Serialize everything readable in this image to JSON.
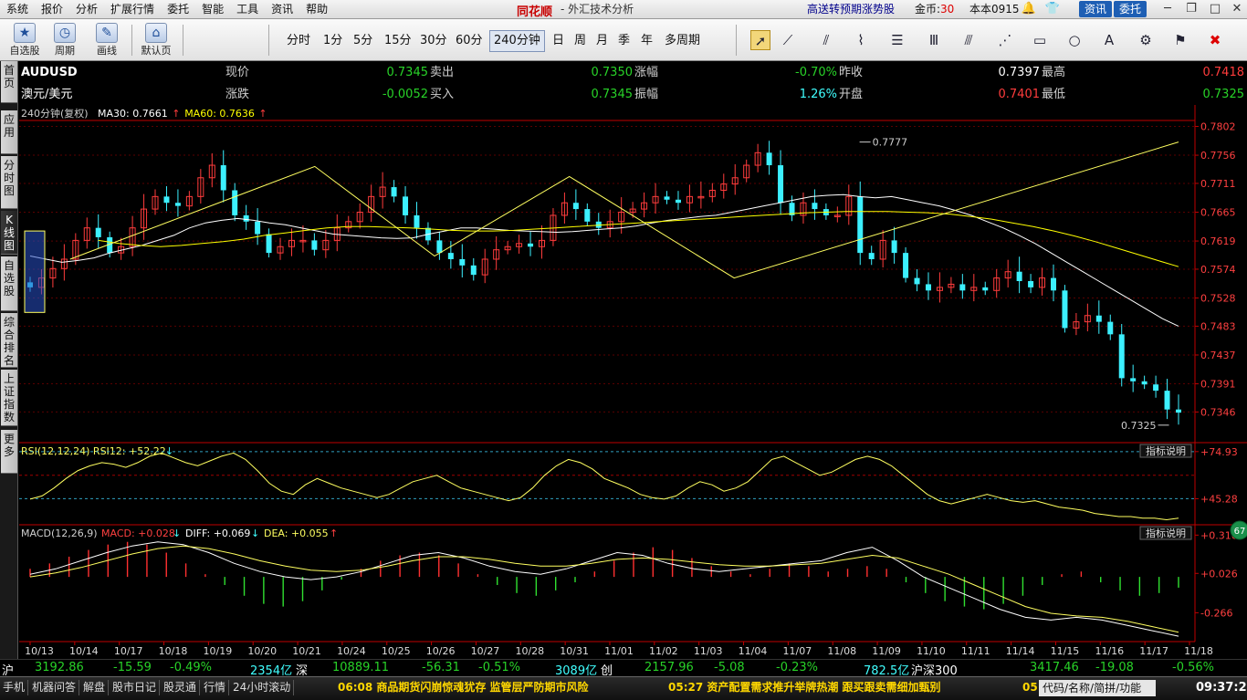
{
  "menu": {
    "items": [
      "系统",
      "报价",
      "分析",
      "扩展行情",
      "委托",
      "智能",
      "工具",
      "资讯",
      "帮助"
    ],
    "brand": "同花顺",
    "app_title": "- 外汇技术分析",
    "promo": "高送转预期涨势股",
    "coins_label": "金币:",
    "coins_value": "30",
    "version": "本本0915",
    "btn_info": "资讯",
    "btn_trade": "委托"
  },
  "toolbar": {
    "big_buttons": [
      "自选股",
      "周期",
      "画线",
      "默认页"
    ],
    "periods": [
      "分时",
      "1分",
      "5分",
      "15分",
      "30分",
      "60分",
      "240分钟",
      "日",
      "周",
      "月",
      "季",
      "年",
      "多周期"
    ],
    "active_period": "240分钟"
  },
  "left_tabs": [
    "首页",
    "应用",
    "分时图",
    "K线图",
    "自选股",
    "综合排名",
    "上证指数",
    "更多"
  ],
  "quote": {
    "code": "AUDUSD",
    "name": "澳元/美元",
    "labels": {
      "now": "现价",
      "sell": "卖出",
      "rise": "涨幅",
      "prev": "昨收",
      "high": "最高",
      "chg": "涨跌",
      "buy": "买入",
      "amp": "振幅",
      "open": "开盘",
      "low": "最低"
    },
    "now": "0.7345",
    "sell": "0.7350",
    "rise": "-0.70%",
    "prev": "0.7397",
    "high": "0.7418",
    "chg": "-0.0052",
    "buy": "0.7345",
    "amp": "1.26%",
    "open": "0.7401",
    "low": "0.7325"
  },
  "chart_data": {
    "type": "candlestick",
    "title": "240分钟(复权)",
    "ma_legend": [
      {
        "name": "MA30",
        "value": "0.7661",
        "arrow": "↑",
        "color": "#ffffff"
      },
      {
        "name": "MA60",
        "value": "0.7636",
        "arrow": "↑",
        "color": "#ffff00"
      }
    ],
    "ylim": [
      0.73,
      0.781
    ],
    "y_ticks": [
      "0.7802",
      "0.7756",
      "0.7711",
      "0.7665",
      "0.7619",
      "0.7574",
      "0.7528",
      "0.7483",
      "0.7437",
      "0.7391",
      "0.7346"
    ],
    "x_labels": [
      "10/13",
      "10/14",
      "10/17",
      "10/18",
      "10/19",
      "10/20",
      "10/21",
      "10/24",
      "10/25",
      "10/26",
      "10/27",
      "10/28",
      "10/31",
      "11/01",
      "11/02",
      "11/03",
      "11/04",
      "11/07",
      "11/08",
      "11/09",
      "11/10",
      "11/11",
      "11/14",
      "11/15",
      "11/16",
      "11/17",
      "11/18"
    ],
    "high_annotation": "0.7777",
    "low_annotation": "0.7325",
    "close_path": [
      0.7545,
      0.756,
      0.7575,
      0.759,
      0.762,
      0.764,
      0.7625,
      0.76,
      0.761,
      0.764,
      0.767,
      0.769,
      0.768,
      0.7675,
      0.769,
      0.772,
      0.774,
      0.77,
      0.766,
      0.765,
      0.763,
      0.76,
      0.761,
      0.762,
      0.762,
      0.7605,
      0.762,
      0.764,
      0.765,
      0.7665,
      0.769,
      0.7705,
      0.769,
      0.766,
      0.764,
      0.762,
      0.76,
      0.759,
      0.758,
      0.7565,
      0.759,
      0.7605,
      0.761,
      0.7615,
      0.761,
      0.762,
      0.766,
      0.768,
      0.767,
      0.765,
      0.764,
      0.765,
      0.7665,
      0.767,
      0.768,
      0.769,
      0.7685,
      0.768,
      0.769,
      0.769,
      0.77,
      0.771,
      0.772,
      0.774,
      0.776,
      0.774,
      0.768,
      0.766,
      0.768,
      0.767,
      0.766,
      0.766,
      0.769,
      0.76,
      0.759,
      0.762,
      0.76,
      0.756,
      0.755,
      0.754,
      0.7545,
      0.755,
      0.754,
      0.7545,
      0.754,
      0.756,
      0.757,
      0.7555,
      0.7545,
      0.756,
      0.754,
      0.748,
      0.749,
      0.75,
      0.749,
      0.747,
      0.74,
      0.7395,
      0.739,
      0.738,
      0.735,
      0.7345
    ],
    "ma30": [
      0.7595,
      0.759,
      0.7585,
      0.7588,
      0.7592,
      0.76,
      0.7606,
      0.7612,
      0.762,
      0.7628,
      0.764,
      0.7648,
      0.7652,
      0.7655,
      0.7652,
      0.7648,
      0.7645,
      0.764,
      0.7635,
      0.763,
      0.7628,
      0.7626,
      0.7624,
      0.7623,
      0.7624,
      0.763,
      0.7635,
      0.764,
      0.764,
      0.7638,
      0.7636,
      0.7635,
      0.7634,
      0.7633,
      0.7634,
      0.7636,
      0.7638,
      0.764,
      0.7643,
      0.7648,
      0.7652,
      0.7655,
      0.7658,
      0.766,
      0.7665,
      0.767,
      0.7675,
      0.768,
      0.7685,
      0.769,
      0.7692,
      0.7693,
      0.769,
      0.7688,
      0.769,
      0.7685,
      0.768,
      0.7675,
      0.7668,
      0.766,
      0.765,
      0.764,
      0.7628,
      0.7615,
      0.76,
      0.7585,
      0.757,
      0.7555,
      0.754,
      0.7525,
      0.751,
      0.7495,
      0.7483
    ],
    "ma60": [
      0.762,
      0.7615,
      0.7612,
      0.761,
      0.7612,
      0.7615,
      0.7618,
      0.7622,
      0.7628,
      0.7632,
      0.7636,
      0.764,
      0.7642,
      0.7642,
      0.7641,
      0.764,
      0.7638,
      0.7636,
      0.7635,
      0.7635,
      0.7636,
      0.7638,
      0.764,
      0.7642,
      0.7644,
      0.7646,
      0.7648,
      0.765,
      0.7652,
      0.7654,
      0.7656,
      0.7658,
      0.766,
      0.7662,
      0.7664,
      0.7665,
      0.7666,
      0.7666,
      0.7666,
      0.7665,
      0.7664,
      0.7662,
      0.7658,
      0.7654,
      0.7648,
      0.7642,
      0.7635,
      0.7627,
      0.7618,
      0.7608,
      0.7598,
      0.7588,
      0.7578
    ],
    "zigzag": [
      [
        8,
        0.759
      ],
      [
        57,
        0.7738
      ],
      [
        81,
        0.7595
      ],
      [
        108,
        0.7722
      ],
      [
        141,
        0.756
      ],
      [
        230,
        0.7777
      ]
    ],
    "rsi": {
      "legend": "RSI(12,12,24)  RSI12: +52.22",
      "arrow": "↓",
      "y_ticks": [
        "+74.93",
        "+45.28"
      ],
      "ylim": [
        30,
        80
      ],
      "values": [
        45,
        47,
        52,
        58,
        63,
        66,
        68,
        67,
        65,
        68,
        72,
        74,
        71,
        68,
        66,
        69,
        72,
        74,
        70,
        63,
        55,
        50,
        48,
        54,
        58,
        55,
        52,
        50,
        48,
        46,
        48,
        52,
        56,
        58,
        60,
        56,
        52,
        50,
        48,
        46,
        44,
        46,
        52,
        60,
        66,
        70,
        68,
        64,
        58,
        55,
        52,
        48,
        46,
        45,
        47,
        52,
        56,
        54,
        50,
        52,
        56,
        63,
        70,
        72,
        68,
        64,
        60,
        62,
        66,
        70,
        72,
        70,
        66,
        60,
        54,
        48,
        44,
        42,
        44,
        46,
        48,
        46,
        44,
        43,
        44,
        42,
        40,
        39,
        38,
        36,
        35,
        34,
        34,
        33,
        33,
        32,
        33
      ]
    },
    "macd": {
      "legend_prefix": "MACD(12,26,9)",
      "macd": "MACD: +0.028",
      "diff": "DIFF: +0.069",
      "dea": "DEA: +0.055",
      "y_ticks": [
        "+0.310",
        "+0.026",
        "-0.266"
      ],
      "ylim": [
        -0.48,
        0.38
      ],
      "hist": [
        0.06,
        0.1,
        0.15,
        0.2,
        0.24,
        0.26,
        0.24,
        0.18,
        0.1,
        0.02,
        -0.06,
        -0.14,
        -0.2,
        -0.22,
        -0.18,
        -0.1,
        -0.02,
        0.06,
        0.12,
        0.16,
        0.18,
        0.16,
        0.1,
        0.02,
        -0.06,
        -0.12,
        -0.14,
        -0.1,
        -0.04,
        0.04,
        0.12,
        0.18,
        0.22,
        0.2,
        0.14,
        0.08,
        0.04,
        0.02,
        0.06,
        0.1,
        0.08,
        0.04,
        0.06,
        0.08,
        0.06,
        -0.04,
        -0.12,
        -0.18,
        -0.22,
        -0.24,
        -0.2,
        -0.14,
        -0.06,
        0.02,
        0.04,
        -0.04,
        -0.1,
        -0.14,
        -0.12,
        -0.08
      ],
      "diff_values": [
        0.02,
        0.06,
        0.12,
        0.18,
        0.23,
        0.26,
        0.24,
        0.18,
        0.1,
        0.04,
        0.0,
        -0.02,
        0.0,
        0.04,
        0.1,
        0.16,
        0.18,
        0.14,
        0.08,
        0.04,
        0.02,
        0.06,
        0.12,
        0.18,
        0.16,
        0.1,
        0.06,
        0.04,
        0.06,
        0.08,
        0.1,
        0.12,
        0.18,
        0.22,
        0.12,
        0.0,
        -0.08,
        -0.16,
        -0.24,
        -0.3,
        -0.32,
        -0.3,
        -0.32,
        -0.36,
        -0.4,
        -0.44
      ],
      "dea_values": [
        0.0,
        0.03,
        0.07,
        0.12,
        0.17,
        0.21,
        0.23,
        0.21,
        0.17,
        0.12,
        0.08,
        0.05,
        0.04,
        0.05,
        0.08,
        0.12,
        0.15,
        0.15,
        0.13,
        0.1,
        0.08,
        0.08,
        0.1,
        0.13,
        0.14,
        0.13,
        0.11,
        0.09,
        0.08,
        0.08,
        0.09,
        0.1,
        0.13,
        0.16,
        0.14,
        0.08,
        0.02,
        -0.06,
        -0.14,
        -0.22,
        -0.27,
        -0.29,
        -0.3,
        -0.33,
        -0.37,
        -0.41
      ]
    },
    "indicator_button": "指标说明",
    "side_badge": "67"
  },
  "index_bar": {
    "sh_label": "沪",
    "sh_value": "3192.86",
    "sh_chg": "-15.59",
    "sh_pct": "-0.49%",
    "sh_amt": "2354亿",
    "sz_label": "深",
    "sz_value": "10889.11",
    "sz_chg": "-56.31",
    "sz_pct": "-0.51%",
    "sz_amt": "3089亿",
    "cy_label": "创",
    "cy_value": "2157.96",
    "cy_chg": "-5.08",
    "cy_pct": "-0.23%",
    "cy_amt": "782.5亿",
    "hs_label": "沪深300",
    "hs_value": "3417.46",
    "hs_chg": "-19.08",
    "hs_pct": "-0.56%"
  },
  "status": {
    "items": [
      "手机",
      "机器问答",
      "解盘",
      "股市日记",
      "股灵通",
      "行情",
      "24小时滚动"
    ],
    "news1": "06:08 商品期货闪崩惊魂犹存 监管层严防期市风险",
    "news2": "05:27 资产配置需求推升举牌热潮 跟买跟卖需细加甄别",
    "news3": "05",
    "search": "代码/名称/简拼/功能",
    "clock": "09:37:22"
  },
  "colors": {
    "up": "#ff3c3c",
    "down": "#3cf0ff",
    "ma30": "#ffffff",
    "ma60": "#ffff00",
    "axis": "#c00000"
  }
}
